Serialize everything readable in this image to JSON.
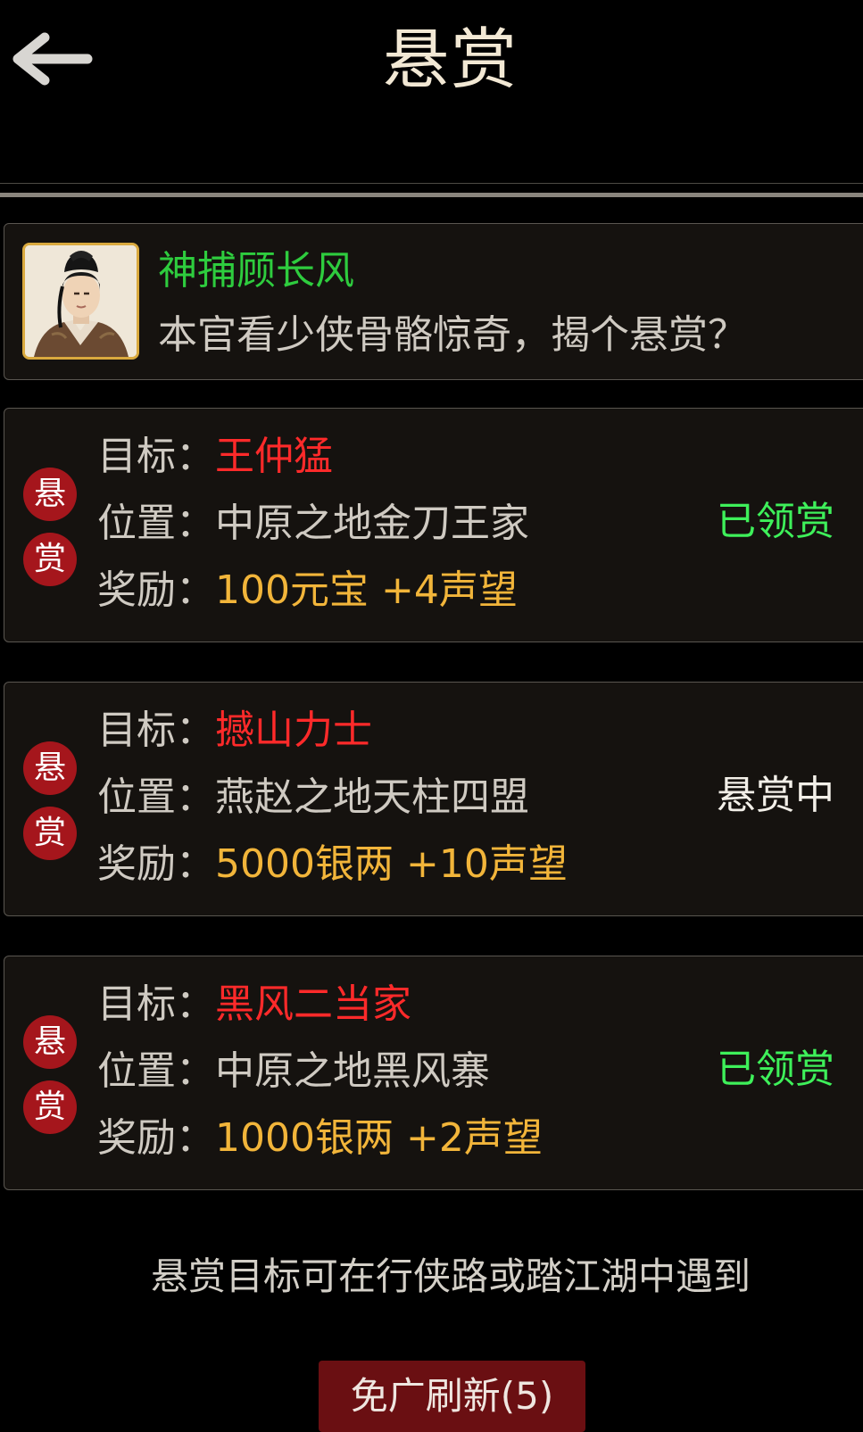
{
  "header": {
    "title": "悬赏",
    "back_icon": "arrow-left-icon"
  },
  "npc": {
    "name": "神捕顾长风",
    "line": "本官看少侠骨骼惊奇，揭个悬赏？",
    "avatar_icon": "npc-portrait-icon"
  },
  "labels": {
    "target": "目标：",
    "location": "位置：",
    "reward": "奖励：",
    "seal_top": "悬",
    "seal_bottom": "赏"
  },
  "bounties": [
    {
      "target": "王仲猛",
      "location": "中原之地金刀王家",
      "reward": "100元宝 +4声望",
      "status": "已领赏",
      "status_color": "#3ef05a"
    },
    {
      "target": "撼山力士",
      "location": "燕赵之地天柱四盟",
      "reward": "5000银两 +10声望",
      "status": "悬赏中",
      "status_color": "#f2efe8"
    },
    {
      "target": "黑风二当家",
      "location": "中原之地黑风寨",
      "reward": "1000银两 +2声望",
      "status": "已领赏",
      "status_color": "#3ef05a"
    }
  ],
  "footer": {
    "note": "悬赏目标可在行侠路或踏江湖中遇到",
    "refresh_button": "免广刷新(5)"
  },
  "colors": {
    "background": "#000000",
    "card": "#15120f",
    "target_red": "#ff2a2a",
    "reward_gold": "#f2b53a",
    "claimed_green": "#3ef05a",
    "npc_green": "#2ecc3e",
    "seal_red": "#a5161c",
    "button": "#6a0f12"
  }
}
